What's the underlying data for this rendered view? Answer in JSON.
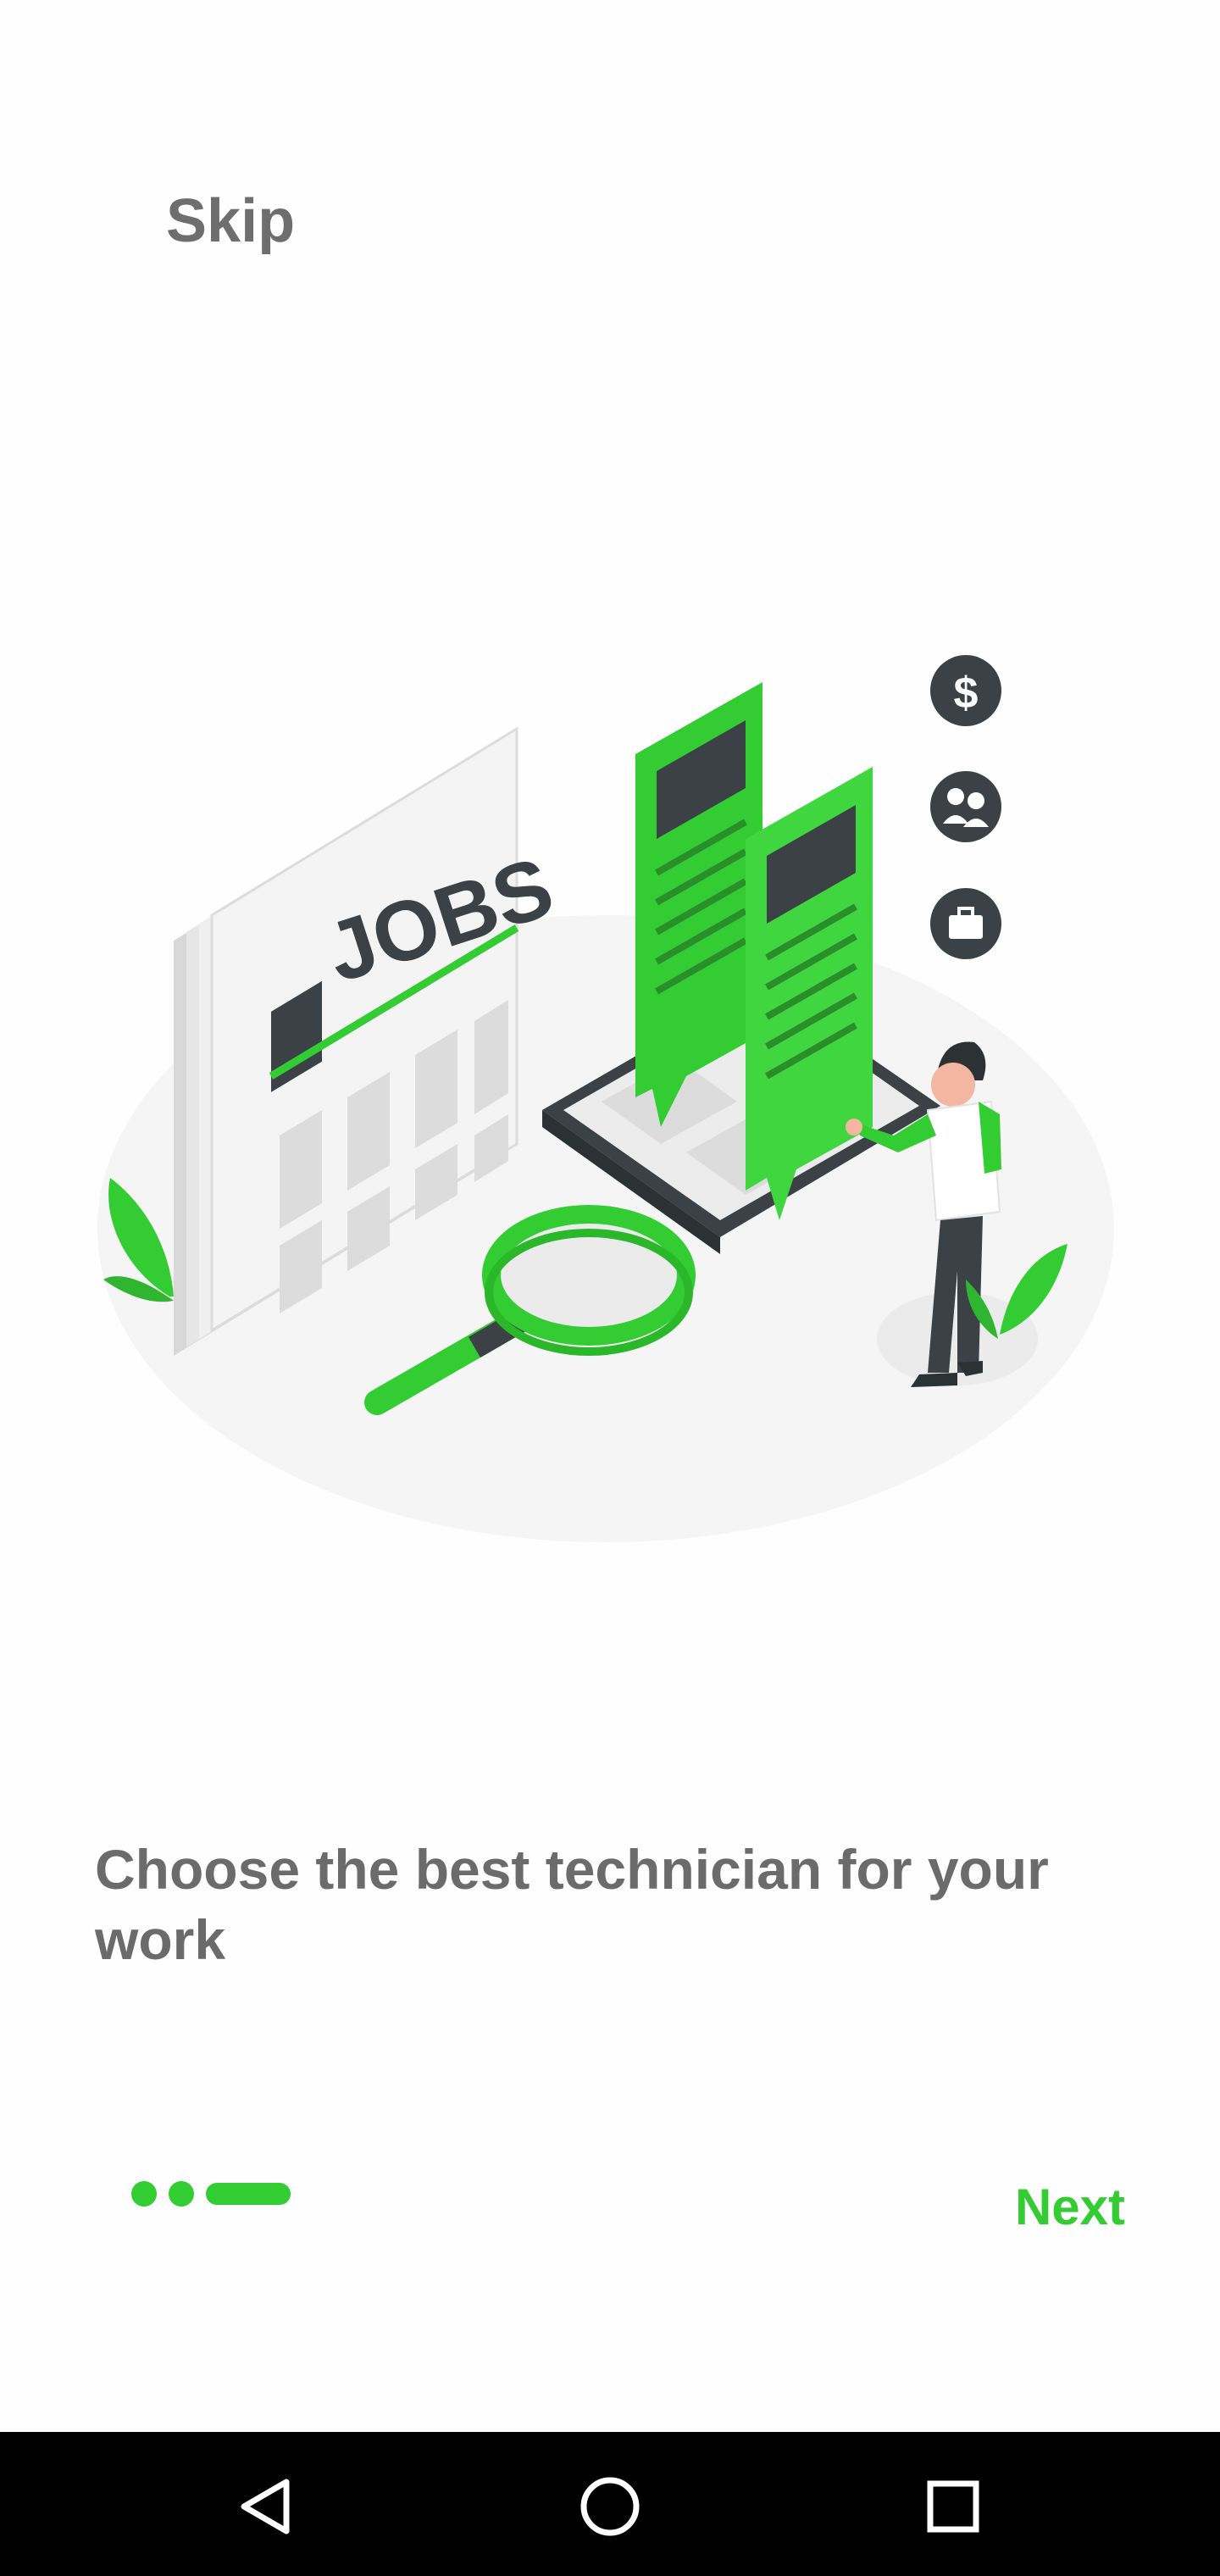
{
  "onboarding": {
    "skip_label": "Skip",
    "headline": "Choose the best technician for your work",
    "next_label": "Next",
    "page_indicator": {
      "total": 3,
      "current": 3
    },
    "illustration": {
      "newspaper_text": "JOBS",
      "icon": "jobs-search-illustration"
    }
  },
  "system_nav": {
    "back": "back-icon",
    "home": "home-icon",
    "recents": "recents-icon"
  },
  "colors": {
    "accent": "#33cc33",
    "text": "#6b6b6b",
    "nav_background": "#000000"
  }
}
